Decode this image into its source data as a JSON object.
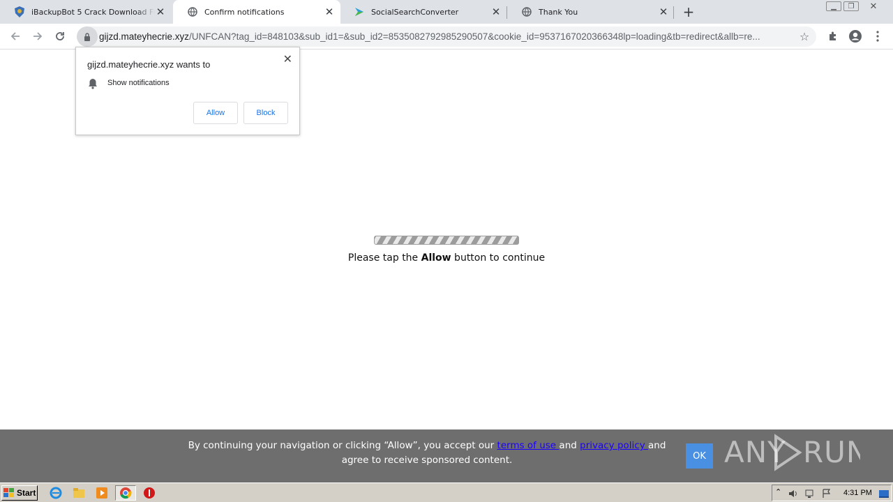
{
  "tabs": [
    {
      "title": "iBackupBot 5 Crack Download Full FREE",
      "icon": "shield-icon"
    },
    {
      "title": "Confirm notifications",
      "icon": "globe-icon",
      "active": true
    },
    {
      "title": "SocialSearchConverter",
      "icon": "arrow-logo-icon"
    },
    {
      "title": "Thank You",
      "icon": "globe-icon"
    }
  ],
  "address": {
    "host": "gijzd.mateyhecrie.xyz",
    "path": "/UNFCAN?tag_id=848103&sub_id1=&sub_id2=8535082792985290507&cookie_id=9537167020366348lp=loading&tb=redirect&allb=re..."
  },
  "popup": {
    "title": "gijzd.mateyhecrie.xyz wants to",
    "permission": "Show notifications",
    "allow": "Allow",
    "block": "Block"
  },
  "page": {
    "continue_prefix": "Please tap the ",
    "continue_bold": "Allow",
    "continue_suffix": " button to continue"
  },
  "consent": {
    "text_a": "By continuing your navigation or clicking “Allow”, you accept our ",
    "terms": "terms of use ",
    "and": "and ",
    "privacy": "privacy policy ",
    "text_b": "and agree to receive sponsored content.",
    "ok": "OK",
    "watermark": "ANY RUN"
  },
  "taskbar": {
    "start": "Start",
    "clock": "4:31 PM"
  },
  "colors": {
    "accent": "#1a73e8",
    "consent_bg": "#6e6e6e",
    "ok_bg": "#4a90e2"
  }
}
